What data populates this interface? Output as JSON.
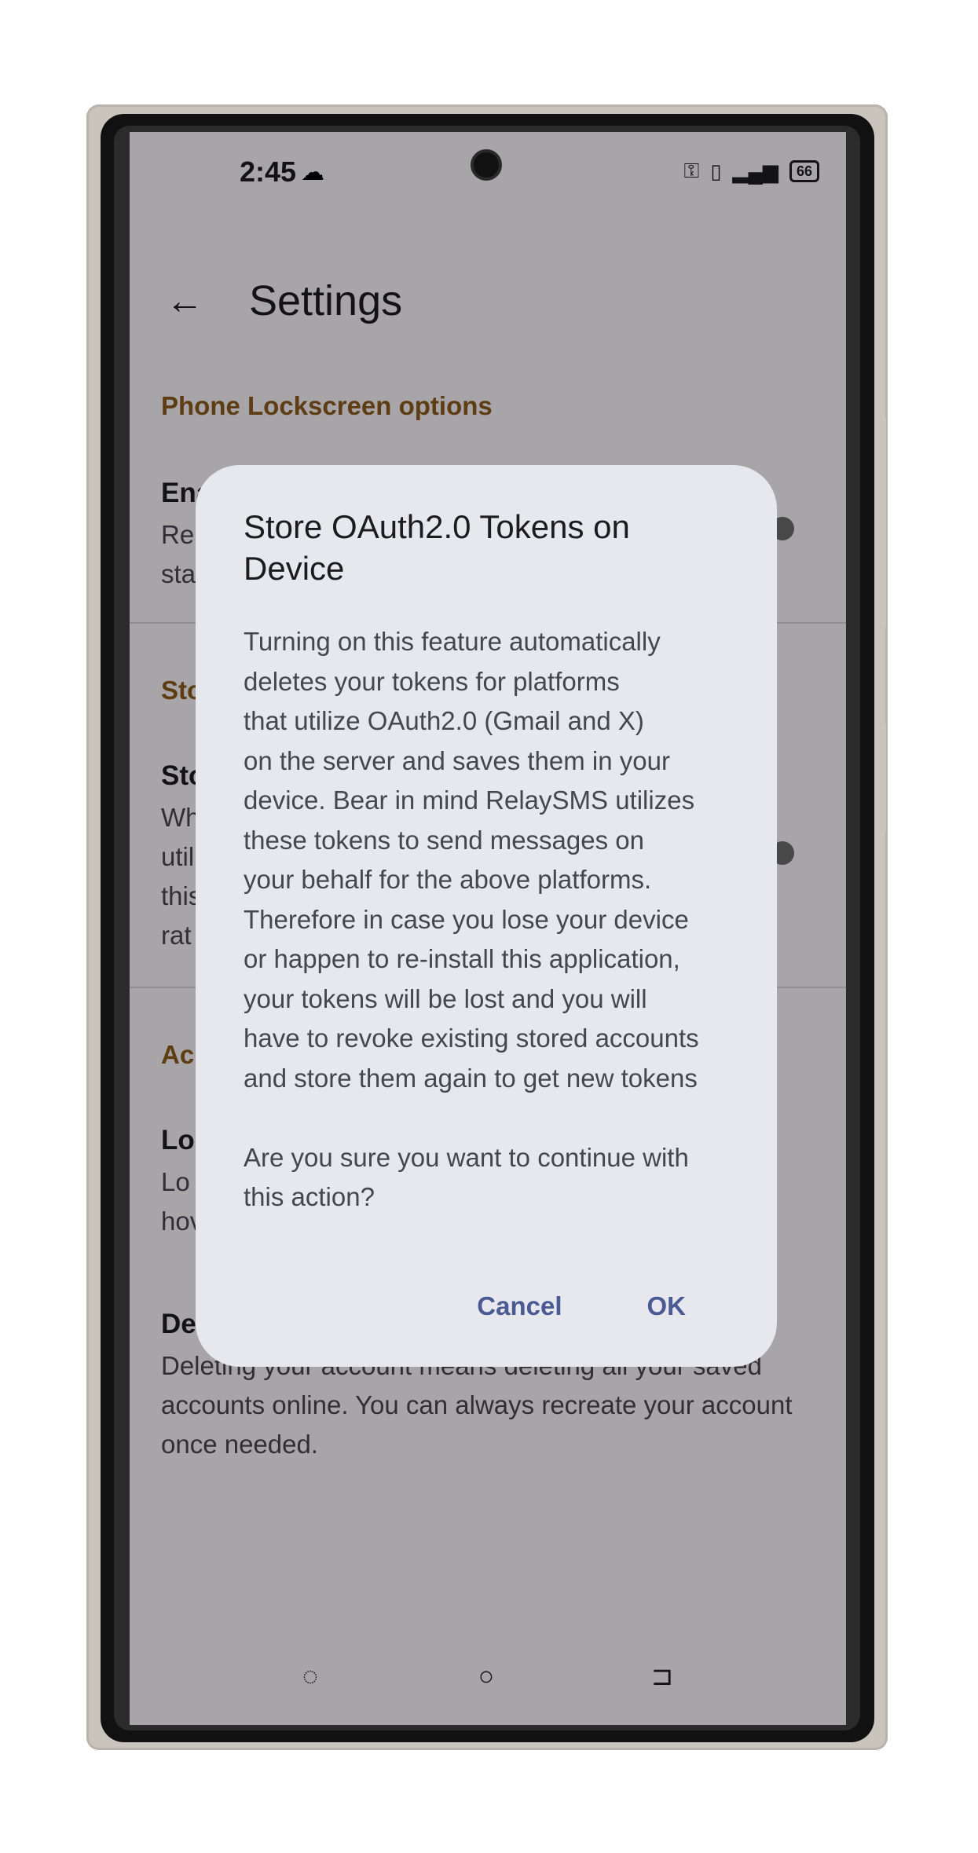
{
  "status_bar": {
    "time": "2:45",
    "battery": "66"
  },
  "app_bar": {
    "title": "Settings"
  },
  "settings": {
    "section1": "Phone Lockscreen options",
    "row1_title": "Ena",
    "row1_sub": "Re\nsta",
    "section2": "Sto",
    "row2_title": "Sto",
    "row2_sub": "Wh\nutil\nthis\nrat",
    "section3": "Ac",
    "row3_title": "Lo",
    "row3_sub": "Lo                                                                     n,\nhov",
    "row4_title": "De",
    "row4_sub": "Deleting your account means deleting all your saved accounts online. You can always recreate your account once needed."
  },
  "dialog": {
    "title": "Store OAuth2.0 Tokens on Device",
    "body": "Turning on this feature automatically\ndeletes your tokens for platforms\nthat utilize OAuth2.0 (Gmail and X)\non the server and saves them in your\ndevice. Bear in mind RelaySMS utilizes\nthese tokens to send messages on\nyour behalf for the above platforms.\nTherefore in case you lose your device\nor happen to re-install this application,\nyour tokens will be lost and you will\nhave to revoke existing stored accounts\nand store them again to get new tokens\n\nAre you sure you want to continue with\nthis action?",
    "cancel_label": "Cancel",
    "ok_label": "OK"
  }
}
